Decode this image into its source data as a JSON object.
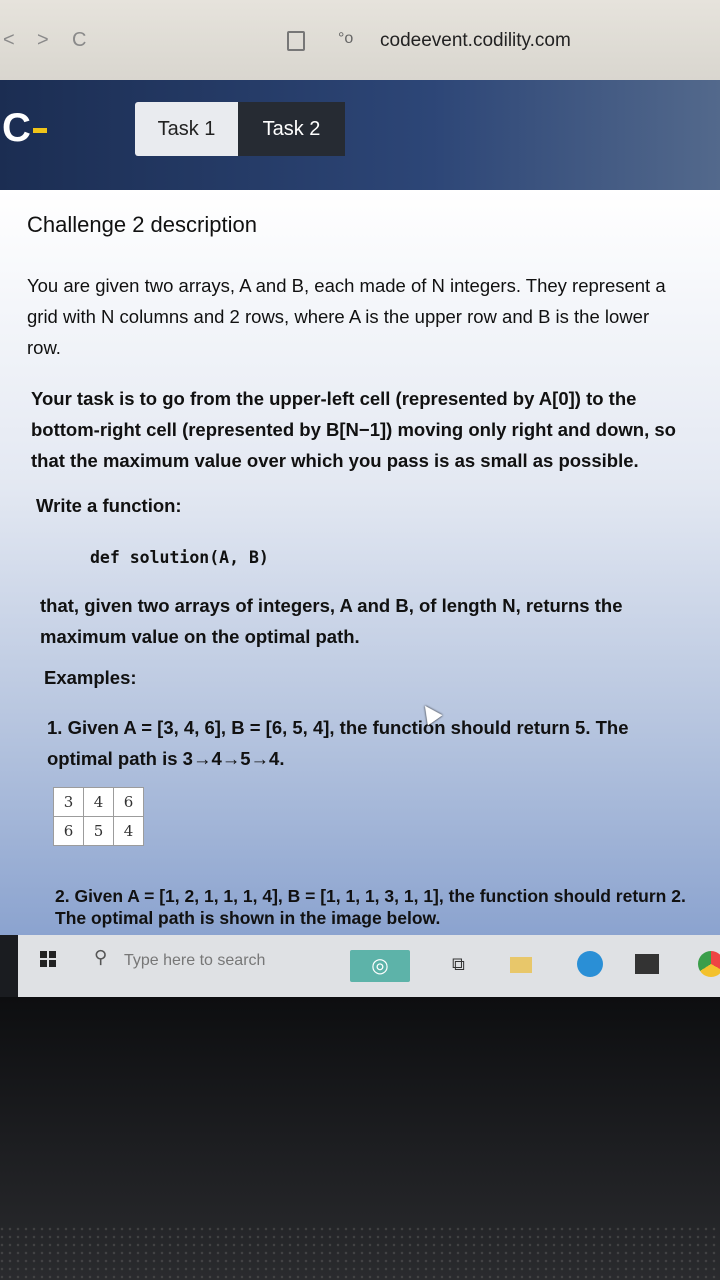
{
  "browser": {
    "back_icon": "<",
    "forward_icon": ">",
    "reload_icon": "C",
    "site_icon": "°o",
    "url": "codeevent.codility.com"
  },
  "header": {
    "logo": "C",
    "tabs": [
      {
        "label": "Task 1",
        "active": false
      },
      {
        "label": "Task 2",
        "active": true
      }
    ]
  },
  "main": {
    "title": "Challenge 2 description",
    "paragraph1": "You are given two arrays, A and B, each made of N integers. They represent a grid with N columns and 2 rows, where A is the upper row and B is the lower row.",
    "paragraph2": "Your task is to go from the upper-left cell (represented by A[0]) to the bottom-right cell (represented by B[N−1]) moving only right and down, so that the maximum value over which you pass is as small as possible.",
    "write_function": "Write a function:",
    "code": "def solution(A, B)",
    "paragraph3": "that, given two arrays of integers, A and B, of length N, returns the maximum value on the optimal path.",
    "examples_heading": "Examples:",
    "example1": "1. Given A = [3, 4, 6], B = [6, 5, 4], the function should return 5. The optimal path is 3→4→5→4.",
    "example1_grid": [
      [
        "3",
        "4",
        "6"
      ],
      [
        "6",
        "5",
        "4"
      ]
    ],
    "example2": "2. Given A = [1, 2, 1, 1, 1, 4], B = [1, 1, 1, 3, 1, 1], the function should return 2. The optimal path is shown in the image below."
  },
  "taskbar": {
    "search_placeholder": "Type here to search",
    "search_icon": "⚲",
    "taskview_icon": "⧉"
  }
}
